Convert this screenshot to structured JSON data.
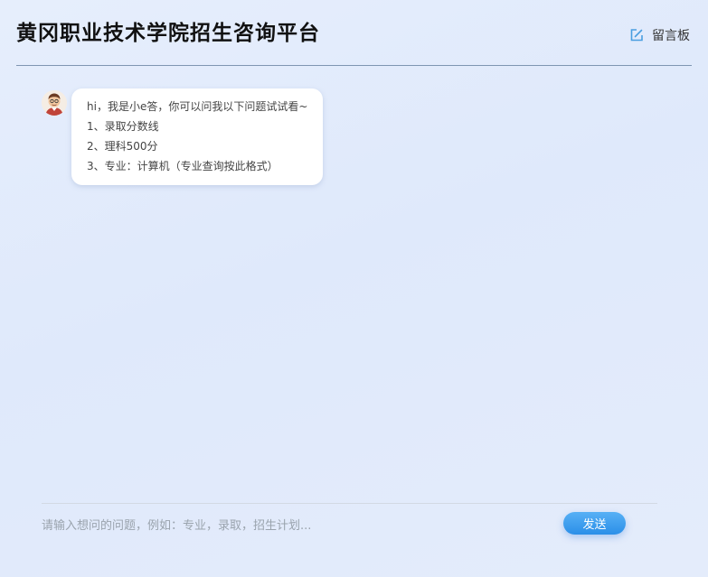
{
  "header": {
    "title": "黄冈职业技术学院招生咨询平台",
    "guestbook_label": "留言板",
    "guestbook_icon": "edit-icon"
  },
  "chat": {
    "messages": [
      {
        "sender": "bot",
        "avatar_icon": "bot-avatar",
        "lines": [
          "hi，我是小e答，你可以问我以下问题试试看~",
          "1、录取分数线",
          "2、理科500分",
          "3、专业：计算机（专业查询按此格式）"
        ]
      }
    ]
  },
  "input": {
    "placeholder": "请输入想问的问题，例如：专业，录取，招生计划...",
    "value": "",
    "send_label": "发送"
  },
  "colors": {
    "accent": "#2b8fe8",
    "divider": "#7f96b2"
  }
}
